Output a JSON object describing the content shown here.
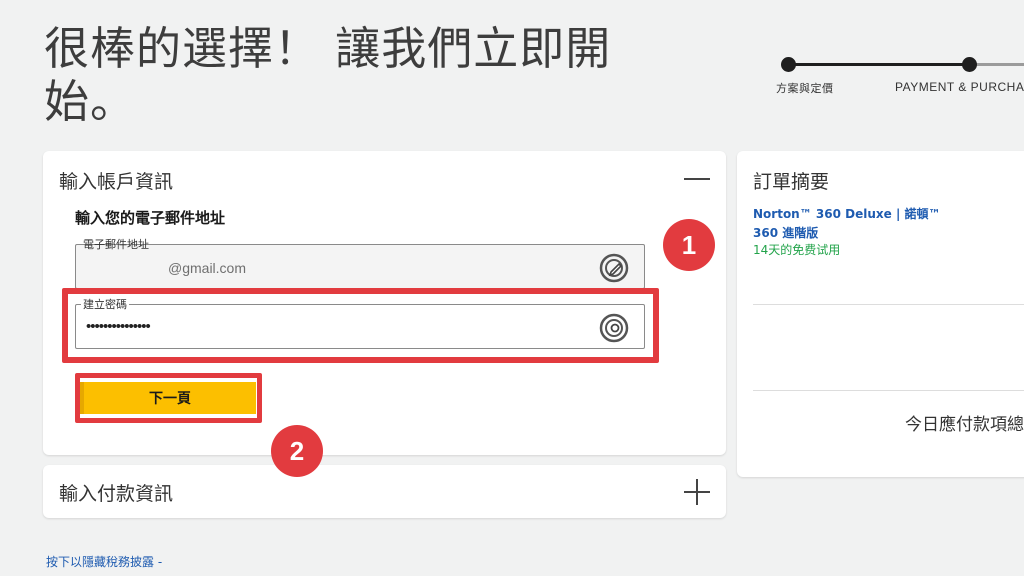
{
  "page": {
    "title": "很棒的選擇！ 讓我們立即開始。"
  },
  "stepper": {
    "steps": [
      {
        "label": "方案與定價",
        "state": "completed"
      },
      {
        "label": "PAYMENT & PURCHA",
        "state": "current"
      }
    ]
  },
  "account": {
    "header": "輸入帳戶資訊",
    "section_label": "輸入您的電子郵件地址",
    "email": {
      "legend": "電子郵件地址",
      "value": "@gmail.com",
      "icon": "edit-icon"
    },
    "password": {
      "legend": "建立密碼",
      "value": "•••••••••••••••",
      "icon": "eye-icon"
    },
    "next_label": "下一頁",
    "collapse_icon": "minus-icon"
  },
  "payment": {
    "header": "輸入付款資訊",
    "expand_icon": "plus-icon"
  },
  "summary": {
    "title": "訂單摘要",
    "product": "Norton™ 360 Deluxe | 諾頓™ 360 進階版",
    "trial": "14天的免费试用",
    "due_today": "今日應付款項總"
  },
  "footer": {
    "tax_link": "按下以隱藏稅務披露 -"
  },
  "annotations": {
    "badge_1": "1",
    "badge_2": "2"
  },
  "colors": {
    "accent_yellow": "#fcbf00",
    "highlight_red": "#e23b3f",
    "link_blue": "#1e5bb0",
    "trial_green": "#22a34a"
  }
}
